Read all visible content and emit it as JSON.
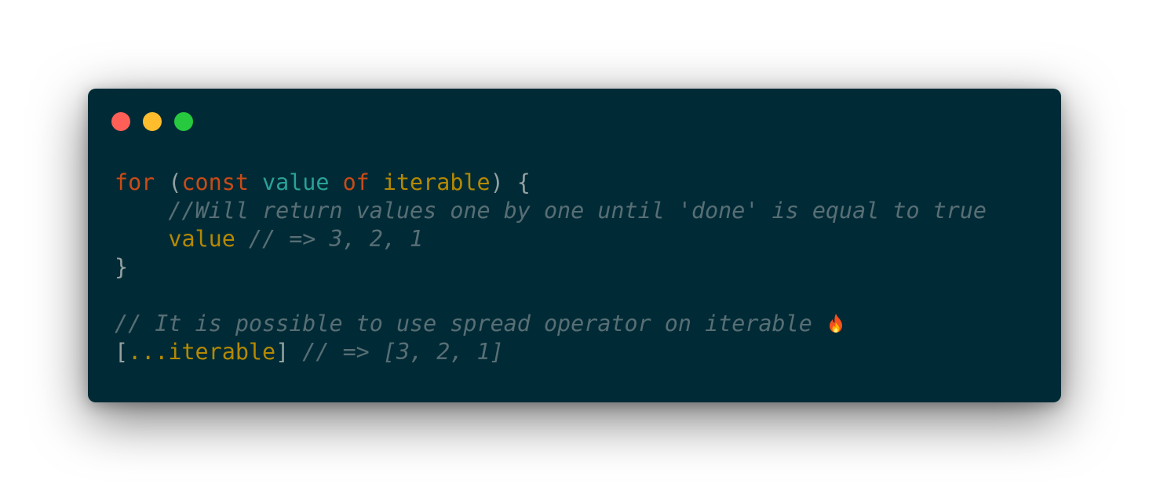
{
  "window": {
    "dot_colors": {
      "close": "#ff5f56",
      "minimize": "#ffbd2e",
      "maximize": "#27c93f"
    }
  },
  "colors": {
    "background": "#002b36",
    "keyword": "#cb4b16",
    "variable": "#2aa198",
    "identifier": "#b58900",
    "comment": "#586e75",
    "punctuation": "#93a1a1"
  },
  "code": {
    "line1": {
      "kw_for": "for",
      "paren_open": " (",
      "kw_const": "const",
      "sp1": " ",
      "var_value": "value",
      "sp2": " ",
      "kw_of": "of",
      "sp3": " ",
      "ident_iterable": "iterable",
      "close": ") {"
    },
    "line2": {
      "indent": "    ",
      "comment": "//Will return values one by one until 'done' is equal to true"
    },
    "line3": {
      "indent": "    ",
      "ident_value": "value",
      "comment": " // => 3, 2, 1"
    },
    "line4": {
      "brace": "}"
    },
    "line5": {
      "blank": ""
    },
    "line6": {
      "comment": "// It is possible to use spread operator on iterable ",
      "emoji": "fire-emoji"
    },
    "line7": {
      "bracket_open": "[",
      "spread": "...iterable",
      "bracket_close": "]",
      "comment": " // => [3, 2, 1]"
    }
  }
}
